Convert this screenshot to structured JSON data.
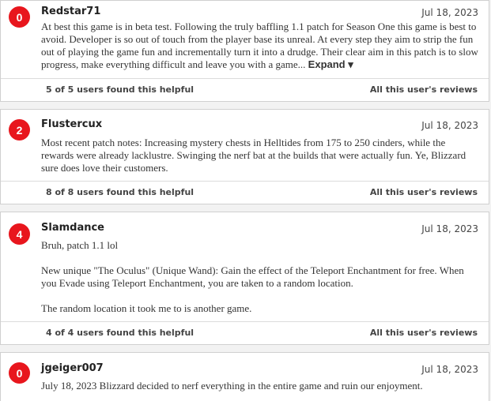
{
  "reviews": [
    {
      "score": "0",
      "author": "Redstar71",
      "date": "Jul 18, 2023",
      "paragraphs": [
        "At best this game is in beta test. Following the truly baffling 1.1 patch for Season One this game is best to avoid. Developer is so out of touch from the player base its unreal. At every step they aim to strip the fun out of playing the game fun and incrementally turn it into a drudge. Their clear aim in this patch is to slow progress, make everything difficult and leave you with a game..."
      ],
      "expand_label": "Expand ▾",
      "helpful": "5 of 5 users found this helpful",
      "all_reviews": "All this user's reviews"
    },
    {
      "score": "2",
      "author": "Flustercux",
      "date": "Jul 18, 2023",
      "paragraphs": [
        "Most recent patch notes: Increasing mystery chests in Helltides from 175 to 250 cinders, while the rewards were already lacklustre. Swinging the nerf bat at the builds that were actually fun. Ye, Blizzard sure does love their customers."
      ],
      "helpful": "8 of 8 users found this helpful",
      "all_reviews": "All this user's reviews"
    },
    {
      "score": "4",
      "author": "Slamdance",
      "date": "Jul 18, 2023",
      "paragraphs": [
        "Bruh, patch 1.1 lol",
        "New unique \"The Oculus\" (Unique Wand): Gain the effect of the Teleport Enchantment for free. When you Evade using Teleport Enchantment, you are taken to a random location.",
        "The random location it took me to is another game."
      ],
      "helpful": "4 of 4 users found this helpful",
      "all_reviews": "All this user's reviews"
    },
    {
      "score": "0",
      "author": "jgeiger007",
      "date": "Jul 18, 2023",
      "paragraphs": [
        "July 18, 2023 Blizzard decided to nerf everything in the entire game and ruin our enjoyment."
      ]
    }
  ],
  "colors": {
    "score_badge": "#e8161d",
    "background": "#f2f2f2"
  }
}
